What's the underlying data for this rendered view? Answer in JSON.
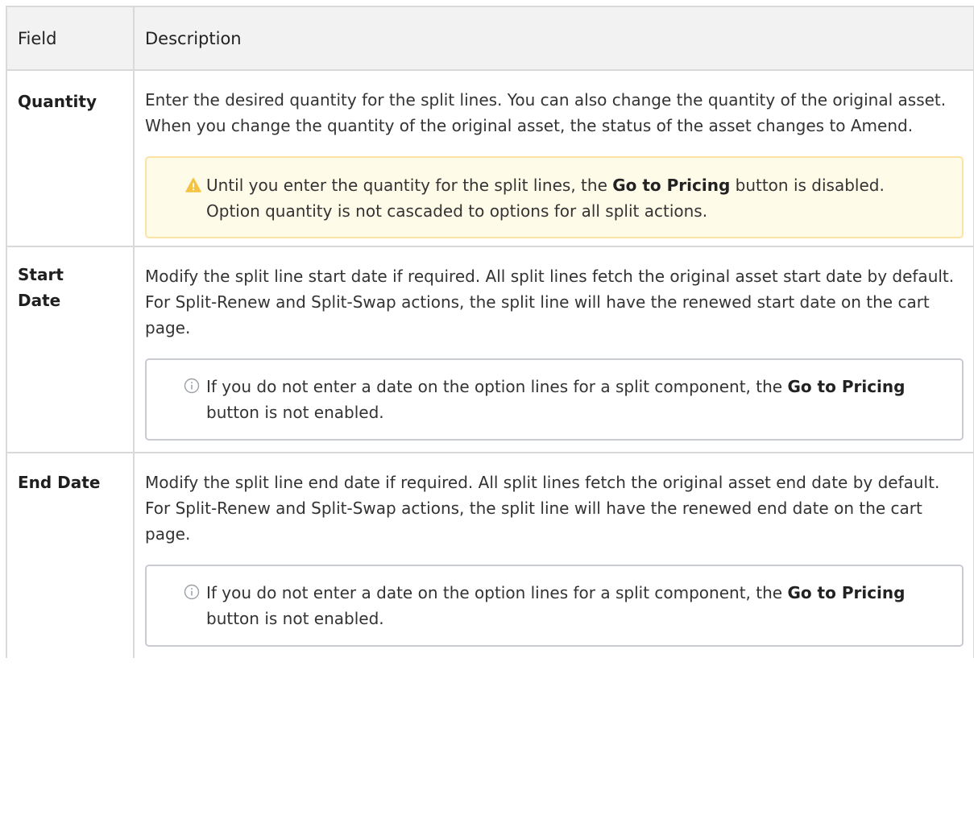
{
  "table": {
    "headers": [
      "Field",
      "Description"
    ],
    "rows": [
      {
        "field": "Quantity",
        "description": "Enter the desired quantity for the split lines. You can also change the quantity of the original asset. When you change the quantity of the original asset, the status of the asset changes to Amend.",
        "note": {
          "type": "warning",
          "icon": "warning-icon",
          "line1_before": "Until you enter the quantity for the split lines, the ",
          "line1_bold": "Go to Pricing",
          "line1_after": " button is disabled.",
          "line2": "Option quantity is not cascaded to options for all split actions."
        }
      },
      {
        "field": "Start Date",
        "description": "Modify the split line start date if required. All split lines fetch the original asset start date by default. For Split-Renew and Split-Swap actions, the split line will have the renewed start date on the cart page.",
        "note": {
          "type": "info",
          "icon": "info-icon",
          "line1_before": "If you do not enter a date on the option lines for a split component, the ",
          "line1_bold": "Go to Pricing",
          "line1_after": " button is not enabled."
        }
      },
      {
        "field": "End Date",
        "description": "Modify the split line end date if required. All split lines fetch the original asset end date by default. For Split-Renew and Split-Swap actions, the split line will have the renewed end date on the cart page.",
        "note": {
          "type": "info",
          "icon": "info-icon",
          "line1_before": "If you do not enter a date on the option lines for a split component, the ",
          "line1_bold": "Go to Pricing",
          "line1_after": " button is not enabled."
        }
      }
    ]
  },
  "colors": {
    "warning_bg": "#fffbe9",
    "warning_border": "#fbe3a4",
    "warning_icon": "#f5c342",
    "info_border": "#c8ccd2",
    "info_icon": "#9aa0a8",
    "header_bg": "#f2f2f2",
    "grid": "#d9d9d9"
  }
}
